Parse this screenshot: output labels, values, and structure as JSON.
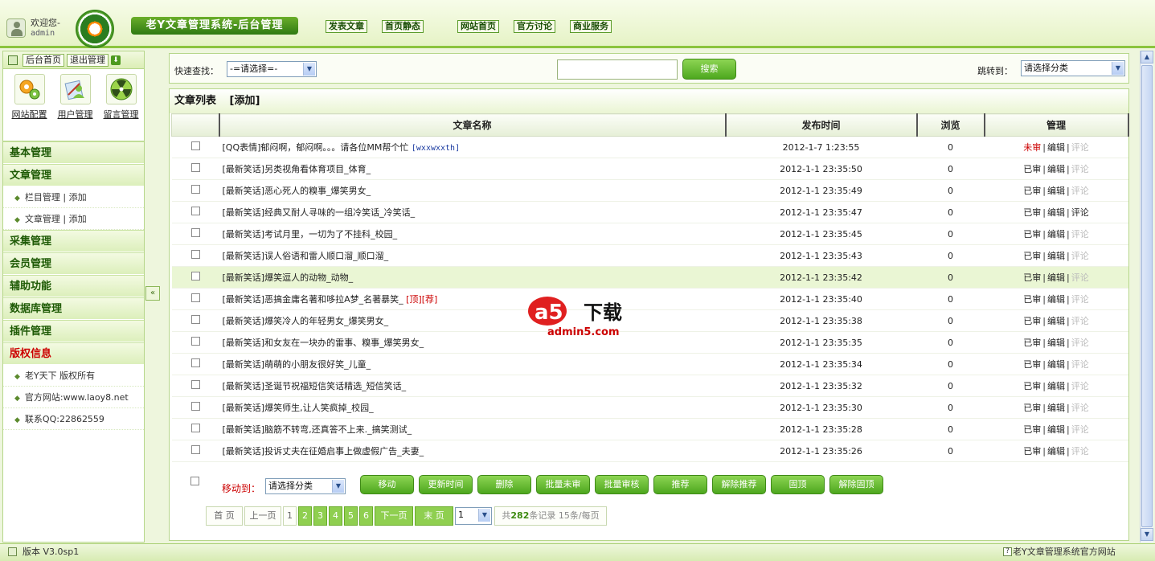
{
  "header": {
    "welcome": "欢迎您-",
    "user": "admin",
    "system_title": "老Y文章管理系统-后台管理",
    "nav": [
      "发表文章",
      "首页静态",
      "网站首页",
      "官方讨论",
      "商业服务"
    ]
  },
  "sidebar": {
    "top_buttons": [
      "后台首页",
      "退出管理"
    ],
    "quick_links": [
      "网站配置",
      "用户管理",
      "留言管理"
    ],
    "menus": [
      {
        "title": "基本管理"
      },
      {
        "title": "文章管理",
        "items": [
          "栏目管理 | 添加",
          "文章管理 | 添加"
        ]
      },
      {
        "title": "采集管理"
      },
      {
        "title": "会员管理"
      },
      {
        "title": "辅助功能"
      },
      {
        "title": "数据库管理"
      },
      {
        "title": "插件管理"
      },
      {
        "title": "版权信息",
        "items": [
          "老Y天下 版权所有",
          "官方网站:www.laoy8.net",
          "联系QQ:22862559"
        ]
      }
    ]
  },
  "search": {
    "quick_label": "快速查找：",
    "quick_select": "-=请选择=-",
    "keyword": "",
    "search_button": "搜索",
    "jump_label": "跳转到：",
    "jump_select": "请选择分类"
  },
  "list": {
    "title": "文章列表",
    "add": "[添加]",
    "columns": [
      "文章名称",
      "发布时间",
      "浏览",
      "管理"
    ],
    "rows": [
      {
        "name": "[QQ表情]郁闷啊，郁闷啊。。。请各位MM帮个忙",
        "tag": "[wxxwxxth]",
        "time": "2012-1-7 1:23:55",
        "views": "0",
        "status": "未审",
        "comment_active": false
      },
      {
        "name": "[最新笑话]另类视角看体育项目_体育_",
        "time": "2012-1-1 23:35:50",
        "views": "0",
        "status": "已审",
        "comment_active": false
      },
      {
        "name": "[最新笑话]恶心死人的糗事_爆笑男女_",
        "time": "2012-1-1 23:35:49",
        "views": "0",
        "status": "已审",
        "comment_active": false
      },
      {
        "name": "[最新笑话]经典又耐人寻味的一组冷笑话_冷笑话_",
        "time": "2012-1-1 23:35:47",
        "views": "0",
        "status": "已审",
        "comment_active": true
      },
      {
        "name": "[最新笑话]考试月里，一切为了不挂科_校园_",
        "time": "2012-1-1 23:35:45",
        "views": "0",
        "status": "已审",
        "comment_active": false
      },
      {
        "name": "[最新笑话]误人俗语和雷人顺口溜_顺口溜_",
        "time": "2012-1-1 23:35:43",
        "views": "0",
        "status": "已审",
        "comment_active": false
      },
      {
        "name": "[最新笑话]爆笑逗人的动物_动物_",
        "time": "2012-1-1 23:35:42",
        "views": "0",
        "status": "已审",
        "comment_active": false
      },
      {
        "name": "[最新笑话]恶搞金庸名著和哆拉A梦_名著暴笑_",
        "tag": "[顶][荐]",
        "time": "2012-1-1 23:35:40",
        "views": "0",
        "status": "已审",
        "comment_active": false
      },
      {
        "name": "[最新笑话]爆笑冷人的年轻男女_爆笑男女_",
        "time": "2012-1-1 23:35:38",
        "views": "0",
        "status": "已审",
        "comment_active": false
      },
      {
        "name": "[最新笑话]和女友在一块办的雷事、糗事_爆笑男女_",
        "time": "2012-1-1 23:35:35",
        "views": "0",
        "status": "已审",
        "comment_active": false
      },
      {
        "name": "[最新笑话]萌萌的小朋友很好笑_儿童_",
        "time": "2012-1-1 23:35:34",
        "views": "0",
        "status": "已审",
        "comment_active": false
      },
      {
        "name": "[最新笑话]圣诞节祝福短信笑话精选_短信笑话_",
        "time": "2012-1-1 23:35:32",
        "views": "0",
        "status": "已审",
        "comment_active": false
      },
      {
        "name": "[最新笑话]爆笑师生,让人笑疯掉_校园_",
        "time": "2012-1-1 23:35:30",
        "views": "0",
        "status": "已审",
        "comment_active": false
      },
      {
        "name": "[最新笑话]脑筋不转弯,还真答不上来._搞笑测试_",
        "time": "2012-1-1 23:35:28",
        "views": "0",
        "status": "已审",
        "comment_active": false
      },
      {
        "name": "[最新笑话]投诉丈夫在征婚启事上做虚假广告_夫妻_",
        "time": "2012-1-1 23:35:26",
        "views": "0",
        "status": "已审",
        "comment_active": false
      }
    ],
    "edit": "编辑",
    "comment": "评论"
  },
  "batch": {
    "move_label": "移动到：",
    "move_select": "请选择分类",
    "buttons": [
      "移动",
      "更新时间",
      "删除",
      "批量未审",
      "批量审核",
      "推荐",
      "解除推荐",
      "固顶",
      "解除固顶"
    ]
  },
  "pager": {
    "first": "首 页",
    "prev": "上一页",
    "pages": [
      "1",
      "2",
      "3",
      "4",
      "5",
      "6"
    ],
    "next": "下一页",
    "last": "末 页",
    "select": "1",
    "total_prefix": "共",
    "total": "282",
    "total_suffix": "条记录 15条/每页"
  },
  "watermark": {
    "brand": "a5下载",
    "url": "admin5.com"
  },
  "footer": {
    "version": "版本 V3.0sp1",
    "official": "老Y文章管理系统官方网站"
  },
  "colors": {
    "accent": "#4da71e",
    "status_pending": "#c00",
    "header_green": "#2f7a12"
  }
}
